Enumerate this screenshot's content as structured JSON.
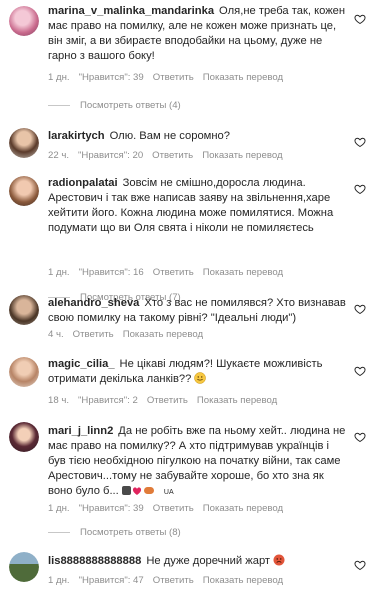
{
  "comments": [
    {
      "username": "marina_v_malinka_mandarinka",
      "text": "Оля,не треба так, кожен має право на помилку, але не кожен може признать це, він зміг, а ви збираєте вподобайки на цьому, дуже не гарно з вашого боку!",
      "time": "1 дн.",
      "likes": "\"Нравится\": 39",
      "reply": "Ответить",
      "translate": "Показать перевод",
      "view_replies": "Посмотреть ответы (4)"
    },
    {
      "username": "larakirtych",
      "text": "Олю. Вам не соромно?",
      "time": "22 ч.",
      "likes": "\"Нравится\": 20",
      "reply": "Ответить",
      "translate": "Показать перевод"
    },
    {
      "username": "radionpalatai",
      "text": "Зовсім не смішно,доросла людина. Арестович і так вже написав заяву на звільнення,харе хейтити його. Кожна людина може помилятися. Можна подумати що ви Оля свята і ніколи не помиляєтесь",
      "time": "1 дн.",
      "likes": "\"Нравится\": 16",
      "reply": "Ответить",
      "translate": "Показать перевод",
      "view_replies": "Посмотреть ответы (7)"
    },
    {
      "username": "alehandro_sheva",
      "text": "Хто з вас не помилявся? Хто визнавав свою помилку на такому рівні? \"Ідеальні люди\")",
      "time": "4 ч.",
      "reply": "Ответить",
      "translate": "Показать перевод"
    },
    {
      "username": "magic_cilia_",
      "text": "Не цікаві людям?! Шукаєте можливість отримати декілька ланків??",
      "time": "18 ч.",
      "likes": "\"Нравится\": 2",
      "reply": "Ответить",
      "translate": "Показать перевод"
    },
    {
      "username": "mari_j_linn2",
      "text": "Да не робіть вже па ньому хейт.. людина не має право на помилку?? А хто підтримував українців і був тією необхідною пігулкою на початку війни, так саме Арестович...тому не забувайте хороше, бо хто зна як воно було б...",
      "emoji_tail": "UA",
      "time": "1 дн.",
      "likes": "\"Нравится\": 39",
      "reply": "Ответить",
      "translate": "Показать перевод",
      "view_replies": "Посмотреть ответы (8)"
    },
    {
      "username": "lis8888888888888",
      "text": "Не дуже доречний жарт",
      "time": "1 дн.",
      "likes": "\"Нравится\": 47",
      "reply": "Ответить",
      "translate": "Показать перевод"
    }
  ],
  "icons": {
    "heart": "heart-outline-icon"
  },
  "colors": {
    "meta_gray": "#8e8e8e",
    "text": "#262626"
  }
}
